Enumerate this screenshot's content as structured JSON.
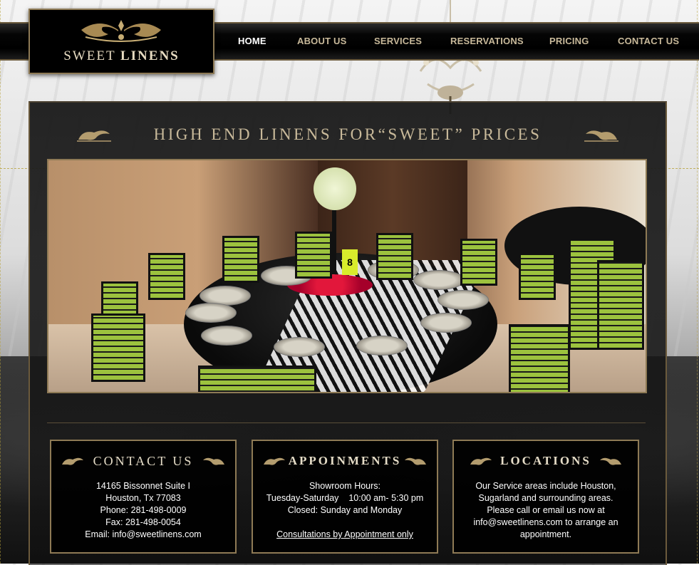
{
  "brand": {
    "word1": "SWEET",
    "word2": "LINENS"
  },
  "nav": {
    "items": [
      {
        "label": "HOME",
        "active": true
      },
      {
        "label": "ABOUT US"
      },
      {
        "label": "SERVICES"
      },
      {
        "label": "RESERVATIONS"
      },
      {
        "label": "PRICING"
      },
      {
        "label": "CONTACT US"
      }
    ]
  },
  "main": {
    "headline": "HIGH END LINENS FOR“SWEET” PRICES",
    "hero_table_number": "8"
  },
  "contact": {
    "title": "CONTACT US",
    "address1": "14165 Bissonnet Suite I",
    "address2": "Houston, Tx 77083",
    "phone": "Phone: 281-498-0009",
    "fax": "Fax: 281-498-0054",
    "email": "Email: info@sweetlinens.com"
  },
  "appointments": {
    "title": "APPOINMENTS",
    "hours_label": "Showroom Hours:",
    "hours": "Tuesday-Saturday    10:00 am- 5:30 pm",
    "closed": "Closed: Sunday and Monday",
    "link": "Consultations by Appointment only"
  },
  "locations": {
    "title": "LOCATIONS",
    "text": "Our Service areas include Houston, Sugarland and surrounding areas. Please call or email us now at info@sweetlinens.com to arrange an appointment."
  },
  "colors": {
    "gold": "#c8b99a",
    "border_gold": "#8e7a55",
    "nav_bg": "#000000",
    "panel_bg": "#1c1c1c"
  }
}
